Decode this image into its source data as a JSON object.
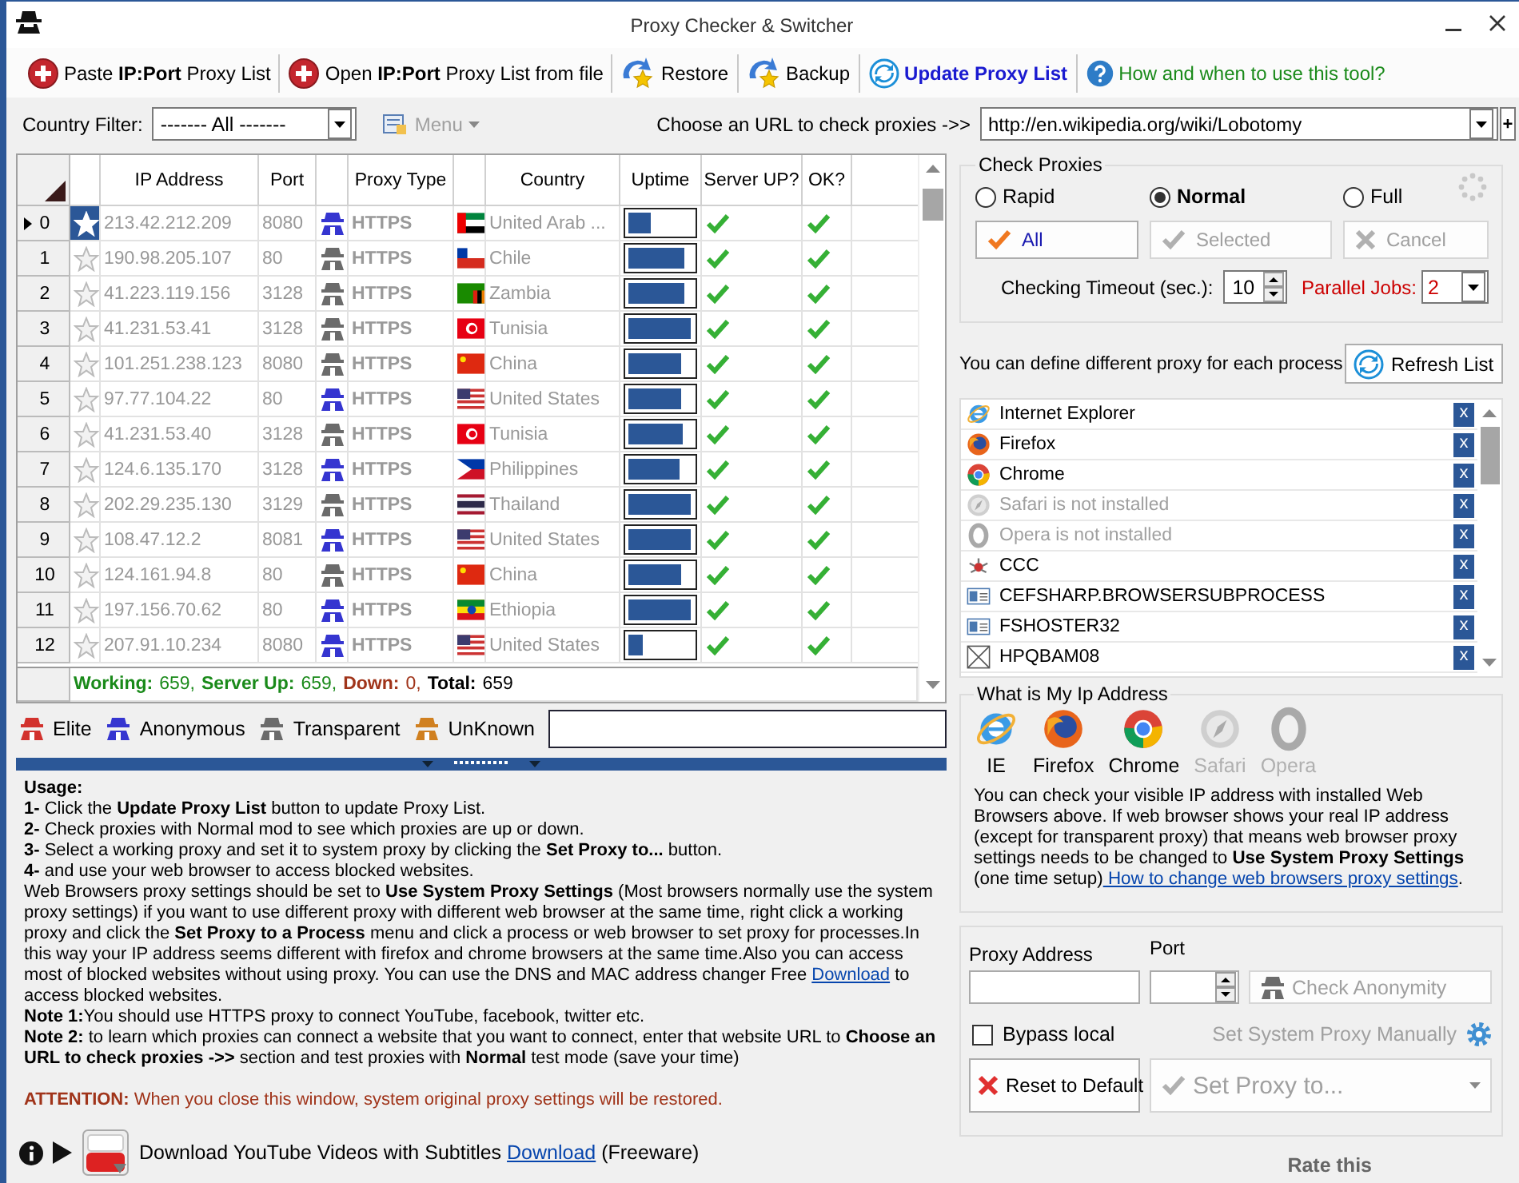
{
  "window": {
    "title": "Proxy Checker & Switcher"
  },
  "toolbar": [
    {
      "kind": "add",
      "text": "Paste **IP:Port** Proxy List"
    },
    {
      "kind": "add",
      "text": "Open **IP:Port** Proxy List from file"
    },
    {
      "kind": "restore",
      "text": "Restore"
    },
    {
      "kind": "backup",
      "text": "Backup"
    },
    {
      "kind": "update",
      "text": "Update Proxy List"
    },
    {
      "kind": "help",
      "text": "How and when to use this tool?"
    }
  ],
  "filter": {
    "label": "Country Filter:",
    "value": "------- All -------",
    "menu": "Menu",
    "menu_disabled": true,
    "url_label": "Choose an URL to check proxies ->>",
    "url": "http://en.wikipedia.org/wiki/Lobotomy",
    "add": "+"
  },
  "grid": {
    "columns": [
      "IP Address",
      "Port",
      "Proxy Type",
      "Country",
      "Uptime",
      "Server UP?",
      "OK?"
    ],
    "rows": [
      {
        "index": "0",
        "selected": true,
        "ip": "213.42.212.209",
        "port": "8080",
        "kind": "anonymous",
        "type": "HTTPS",
        "flag": {
          "kind": "ae"
        },
        "country": "United Arab ...",
        "level": 0.35,
        "server_up": true,
        "ok": true
      },
      {
        "index": "1",
        "selected": false,
        "ip": "190.98.205.107",
        "port": "80",
        "kind": "transparent",
        "type": "HTTPS",
        "flag": {
          "kind": "cl"
        },
        "country": "Chile",
        "level": 0.87,
        "server_up": true,
        "ok": true
      },
      {
        "index": "2",
        "selected": false,
        "ip": "41.223.119.156",
        "port": "3128",
        "kind": "transparent",
        "type": "HTTPS",
        "flag": {
          "kind": "zm"
        },
        "country": "Zambia",
        "level": 0.87,
        "server_up": true,
        "ok": true
      },
      {
        "index": "3",
        "selected": false,
        "ip": "41.231.53.41",
        "port": "3128",
        "kind": "transparent",
        "type": "HTTPS",
        "flag": {
          "kind": "tn"
        },
        "country": "Tunisia",
        "level": 0.97,
        "server_up": true,
        "ok": true
      },
      {
        "index": "4",
        "selected": false,
        "ip": "101.251.238.123",
        "port": "8080",
        "kind": "transparent",
        "type": "HTTPS",
        "flag": {
          "kind": "cn"
        },
        "country": "China",
        "level": 0.82,
        "server_up": true,
        "ok": true
      },
      {
        "index": "5",
        "selected": false,
        "ip": "97.77.104.22",
        "port": "80",
        "kind": "anonymous",
        "type": "HTTPS",
        "flag": {
          "kind": "us"
        },
        "country": "United States",
        "level": 0.82,
        "server_up": true,
        "ok": true
      },
      {
        "index": "6",
        "selected": false,
        "ip": "41.231.53.40",
        "port": "3128",
        "kind": "transparent",
        "type": "HTTPS",
        "flag": {
          "kind": "tn"
        },
        "country": "Tunisia",
        "level": 0.84,
        "server_up": true,
        "ok": true
      },
      {
        "index": "7",
        "selected": false,
        "ip": "124.6.135.170",
        "port": "3128",
        "kind": "anonymous",
        "type": "HTTPS",
        "flag": {
          "kind": "ph"
        },
        "country": "Philippines",
        "level": 0.8,
        "server_up": true,
        "ok": true
      },
      {
        "index": "8",
        "selected": false,
        "ip": "202.29.235.130",
        "port": "3129",
        "kind": "transparent",
        "type": "HTTPS",
        "flag": {
          "kind": "th"
        },
        "country": "Thailand",
        "level": 0.97,
        "server_up": true,
        "ok": true
      },
      {
        "index": "9",
        "selected": false,
        "ip": "108.47.12.2",
        "port": "8081",
        "kind": "anonymous",
        "type": "HTTPS",
        "flag": {
          "kind": "us"
        },
        "country": "United States",
        "level": 0.97,
        "server_up": true,
        "ok": true
      },
      {
        "index": "10",
        "selected": false,
        "ip": "124.161.94.8",
        "port": "80",
        "kind": "transparent",
        "type": "HTTPS",
        "flag": {
          "kind": "cn"
        },
        "country": "China",
        "level": 0.82,
        "server_up": true,
        "ok": true
      },
      {
        "index": "11",
        "selected": false,
        "ip": "197.156.70.62",
        "port": "80",
        "kind": "anonymous",
        "type": "HTTPS",
        "flag": {
          "kind": "et"
        },
        "country": "Ethiopia",
        "level": 0.97,
        "server_up": true,
        "ok": true
      },
      {
        "index": "12",
        "selected": false,
        "ip": "207.91.10.234",
        "port": "8080",
        "kind": "anonymous",
        "type": "HTTPS",
        "flag": {
          "kind": "us"
        },
        "country": "United States",
        "level": 0.23,
        "server_up": true,
        "ok": true
      }
    ],
    "status": [
      {
        "label": "Working:",
        "value": "659,",
        "color": "#1a8a1a"
      },
      {
        "label": "Server Up:",
        "value": "659,",
        "color": "#1a8a1a"
      },
      {
        "label": "Down:",
        "value": "0,",
        "color": "#a0341a"
      },
      {
        "label": "Total:",
        "value": "659",
        "color": "#000000"
      }
    ]
  },
  "legend": [
    {
      "kind": "elite",
      "label": "Elite"
    },
    {
      "kind": "anonymous",
      "label": "Anonymous"
    },
    {
      "kind": "transparent",
      "label": "Transparent"
    },
    {
      "kind": "unknown",
      "label": "UnKnown"
    }
  ],
  "usage": [
    {
      "text": "**Usage:**"
    },
    {
      "text": "**1-** Click the **Update Proxy List** button to update Proxy List."
    },
    {
      "text": "**2-** Check proxies with Normal mod to see which proxies are up or down."
    },
    {
      "text": "**3-** Select a working proxy and set it to system proxy by clicking the **Set Proxy to...** button."
    },
    {
      "text": "**4-** and use your web browser to access blocked websites."
    },
    {
      "text": "Web Browsers proxy settings should be set to **Use System Proxy Settings** (Most browsers normally use the system proxy settings) if you want to use different proxy with different web browser at the same time, right click a working proxy and click the **Set Proxy to a Process** menu and click a process or web browser to set proxy for processes.In this way your IP address seems different with firefox and chrome browsers at the same time.Also you can access most of blocked websites without using proxy. You can use the DNS and MAC address changer Free ",
      "link": "Download",
      "after": " to access blocked websites."
    },
    {
      "text": "**Note 1:**You should use HTTPS proxy to connect YouTube, facebook, twitter etc."
    },
    {
      "text": "**Note 2:** to learn which proxies can connect a website that you want to connect, enter that website URL to **Choose an URL to check proxies ->>** section and test proxies with **Normal** test mode (save your time)"
    }
  ],
  "attention": {
    "label": "ATTENTION:",
    "text": "When you close this window, system original proxy settings will be restored."
  },
  "footer": {
    "text": "Download YouTube Videos with Subtitles ",
    "link": "Download",
    "after": " (Freeware)",
    "rate": "Rate this"
  },
  "check": {
    "title": "Check Proxies",
    "modes": [
      {
        "label": "Rapid",
        "selected": false
      },
      {
        "label": "Normal",
        "selected": true
      },
      {
        "label": "Full",
        "selected": false
      }
    ],
    "buttons": [
      {
        "kind": "all",
        "label": "All",
        "disabled": false
      },
      {
        "kind": "selected",
        "label": "Selected",
        "disabled": true
      },
      {
        "kind": "cancel",
        "label": "Cancel",
        "disabled": true
      }
    ],
    "timeout_label": "Checking Timeout (sec.):",
    "timeout": "10",
    "jobs_label": "Parallel Jobs:",
    "jobs": "2"
  },
  "processes": {
    "hint": "You can define different proxy for each process",
    "refresh": "Refresh List",
    "items": [
      {
        "kind": "ie",
        "name": "Internet Explorer",
        "installed": true,
        "remove": "x"
      },
      {
        "kind": "firefox",
        "name": "Firefox",
        "installed": true,
        "remove": "x"
      },
      {
        "kind": "chrome",
        "name": "Chrome",
        "installed": true,
        "remove": "x"
      },
      {
        "kind": "safari",
        "name": "Safari is not installed",
        "installed": false,
        "remove": "x"
      },
      {
        "kind": "opera",
        "name": "Opera is not installed",
        "installed": false,
        "remove": "x"
      },
      {
        "kind": "ccc",
        "name": "CCC",
        "installed": true,
        "remove": "x"
      },
      {
        "kind": "app",
        "name": "CEFSHARP.BROWSERSUBPROCESS",
        "installed": true,
        "remove": "x"
      },
      {
        "kind": "app",
        "name": "FSHOSTER32",
        "installed": true,
        "remove": "x"
      },
      {
        "kind": "blank",
        "name": "HPQBAM08",
        "installed": true,
        "remove": "x"
      }
    ]
  },
  "myip": {
    "title": "What is My Ip Address",
    "browsers": [
      {
        "kind": "ie",
        "name": "IE",
        "installed": true
      },
      {
        "kind": "firefox",
        "name": "Firefox",
        "installed": true
      },
      {
        "kind": "chrome",
        "name": "Chrome",
        "installed": true
      },
      {
        "kind": "safari",
        "name": "Safari",
        "installed": false
      },
      {
        "kind": "opera",
        "name": "Opera",
        "installed": false
      }
    ],
    "text": "You can check your visible IP address with installed Web Browsers above. If web browser shows your real IP address (except for transparent proxy) that means web browser proxy settings needs to be changed to **Use System Proxy Settings** (one time setup)",
    "link": " How to change web browsers proxy settings",
    "after": "."
  },
  "manual": {
    "address_label": "Proxy Address",
    "port_label": "Port",
    "check": "Check Anonymity",
    "check_disabled": true,
    "bypass": {
      "label": "Bypass local",
      "checked": false
    },
    "manual_link": "Set System Proxy Manually",
    "reset": "Reset to Default",
    "set": "Set Proxy to...",
    "set_disabled": true
  }
}
